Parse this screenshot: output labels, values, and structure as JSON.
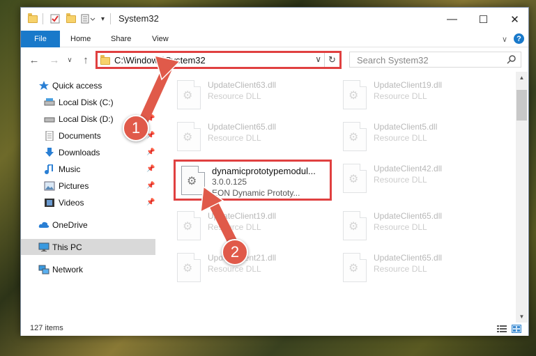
{
  "window": {
    "title": "System32",
    "minimize": "—",
    "maximize": "☐",
    "close": "✕"
  },
  "ribbon": {
    "tabs": [
      "File",
      "Home",
      "Share",
      "View"
    ],
    "expand": "∨",
    "help": "?"
  },
  "address": {
    "path": "C:\\Windows\\System32",
    "dropdown": "∨",
    "refresh": "↻"
  },
  "search": {
    "placeholder": "Search System32"
  },
  "nav": {
    "back": "←",
    "forward": "→",
    "recent": "∨",
    "up": "↑",
    "items": [
      {
        "label": "Quick access",
        "icon": "star-icon",
        "pinned": false
      },
      {
        "label": "Local Disk (C:)",
        "icon": "drive-icon",
        "pinned": false
      },
      {
        "label": "Local Disk (D:)",
        "icon": "drive-icon",
        "pinned": true
      },
      {
        "label": "Documents",
        "icon": "documents-icon",
        "pinned": true
      },
      {
        "label": "Downloads",
        "icon": "download-icon",
        "pinned": true
      },
      {
        "label": "Music",
        "icon": "music-icon",
        "pinned": true
      },
      {
        "label": "Pictures",
        "icon": "pictures-icon",
        "pinned": true
      },
      {
        "label": "Videos",
        "icon": "videos-icon",
        "pinned": true
      },
      {
        "label": "OneDrive",
        "icon": "cloud-icon",
        "pinned": false
      },
      {
        "label": "This PC",
        "icon": "computer-icon",
        "pinned": false
      },
      {
        "label": "Network",
        "icon": "network-icon",
        "pinned": false
      }
    ]
  },
  "files": {
    "left": [
      {
        "name": "UpdateClient63.dll",
        "type": "Resource DLL"
      },
      {
        "name": "UpdateClient65.dll",
        "type": "Resource DLL"
      },
      {
        "name": "dynamicprototypemodul...",
        "version": "3.0.0.125",
        "desc": "EON Dynamic Prototy..."
      },
      {
        "name": "UpdateClient19.dll",
        "type": "Resource DLL"
      },
      {
        "name": "UpdateClient21.dll",
        "type": "Resource DLL"
      }
    ],
    "right": [
      {
        "name": "UpdateClient19.dll",
        "type": "Resource DLL"
      },
      {
        "name": "UpdateClient5.dll",
        "type": "Resource DLL"
      },
      {
        "name": "UpdateClient42.dll",
        "type": "Resource DLL"
      },
      {
        "name": "UpdateClient65.dll",
        "type": "Resource DLL"
      },
      {
        "name": "UpdateClient65.dll",
        "type": "Resource DLL"
      }
    ]
  },
  "status": {
    "count": "127 items"
  },
  "callouts": [
    "1",
    "2"
  ],
  "colors": {
    "accent": "#1979ca",
    "highlight": "#e04040",
    "callout": "#e05a4a"
  }
}
